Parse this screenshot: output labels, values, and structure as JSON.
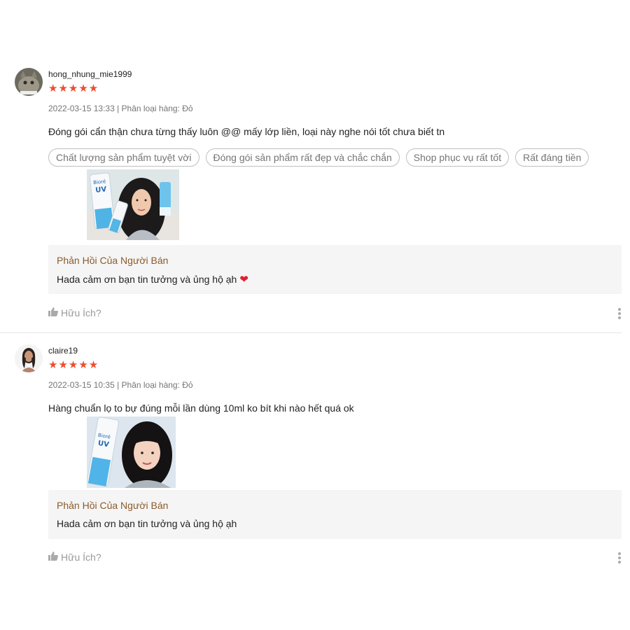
{
  "reviews": [
    {
      "username": "hong_nhung_mie1999",
      "stars": "★★★★★",
      "rating": 5,
      "meta": "2022-03-15 13:33 | Phân loại hàng: Đỏ",
      "comment": "Đóng gói cẩn thận chưa từng thấy luôn @@ mấy lớp liền, loại này nghe nói tốt chưa biết tn",
      "tags": [
        "Chất lượng sản phẩm tuyệt vời",
        "Đóng gói sản phẩm rất đẹp và chắc chắn",
        "Shop phục vụ rất tốt",
        "Rất đáng tiền"
      ],
      "product_brand": "Bioré",
      "product_line": "UV",
      "reply_title": "Phản Hồi Của Người Bán",
      "reply_text": "Hada cảm ơn bạn tin tưởng và ủng hộ ạh",
      "helpful_label": "Hữu Ích?"
    },
    {
      "username": "claire19",
      "stars": "★★★★★",
      "rating": 5,
      "meta": "2022-03-15 10:35 | Phân loại hàng: Đỏ",
      "comment": "Hàng chuẩn lọ to bự đúng mỗi lần dùng 10ml ko bít khi nào hết quá ok",
      "tags": [],
      "product_brand": "Bioré",
      "product_line": "UV",
      "reply_title": "Phản Hồi Của Người Bán",
      "reply_text": "Hada cảm ơn bạn tin tưởng và ủng hộ ạh",
      "helpful_label": "Hữu Ích?"
    }
  ],
  "colors": {
    "star": "#ee4d2d",
    "reply_title": "#8b5a2b",
    "reply_bg": "#f5f5f5",
    "heart": "#e02030"
  },
  "icons": [
    "thumbs-up-icon",
    "more-vertical-icon",
    "heart-icon",
    "star-icon"
  ]
}
